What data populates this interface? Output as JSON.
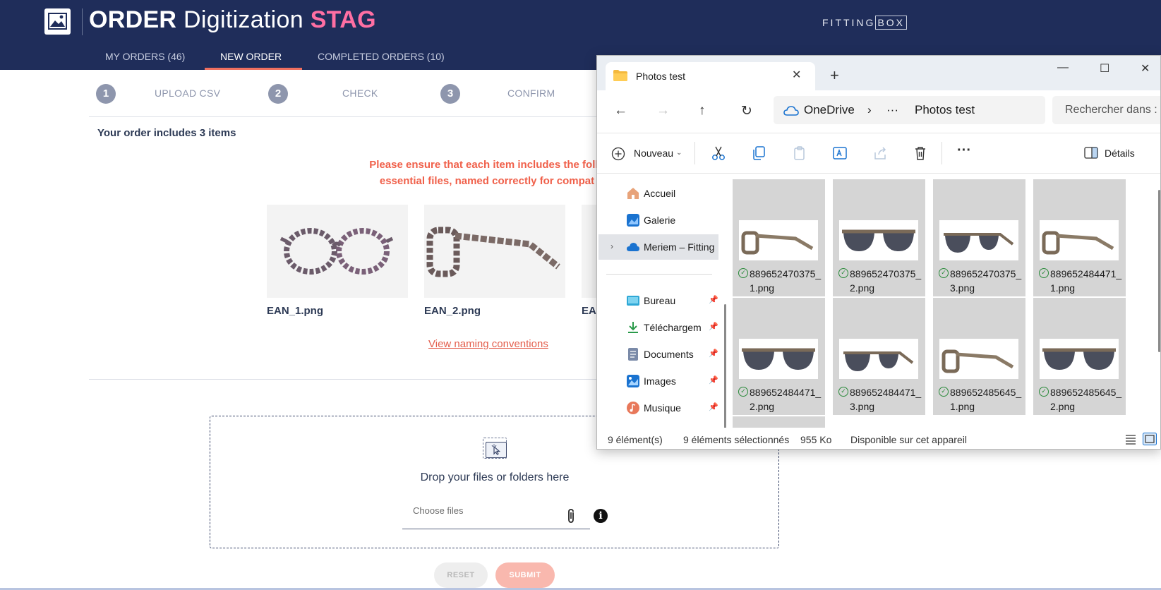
{
  "app": {
    "title_part1": "ORDER",
    "title_part2": "Digitization",
    "title_part3": "STAG",
    "partner_logo_text_1": "FITTING",
    "partner_logo_text_2": "BOX",
    "nav": [
      {
        "label": "MY ORDERS (46)"
      },
      {
        "label": "NEW ORDER"
      },
      {
        "label": "COMPLETED ORDERS (10)"
      }
    ],
    "steps": [
      {
        "num": "1",
        "label": "UPLOAD CSV"
      },
      {
        "num": "2",
        "label": "CHECK"
      },
      {
        "num": "3",
        "label": "CONFIRM"
      }
    ],
    "order_summary": "Your order includes 3 items",
    "warning_line1": "Please ensure that each item includes the follo",
    "warning_line2": "essential files, named correctly for compat",
    "examples": [
      {
        "name": "EAN_1.png"
      },
      {
        "name": "EAN_2.png"
      },
      {
        "name": "EA"
      }
    ],
    "naming_link": "View naming conventions",
    "drop_text": "Drop your files or folders here",
    "choose_placeholder": "Choose files",
    "info_glyph": "i",
    "reset_label": "RESET",
    "submit_label": "SUBMIT"
  },
  "explorer": {
    "tab_title": "Photos test",
    "address_root": "OneDrive",
    "address_sep": "›",
    "address_more": "···",
    "address_folder": "Photos test",
    "search_placeholder": "Rechercher dans :",
    "new_label": "Nouveau",
    "details_label": "Détails",
    "sidebar": [
      {
        "label": "Accueil",
        "icon": "home-icon",
        "pinned": false
      },
      {
        "label": "Galerie",
        "icon": "gallery-icon",
        "pinned": false
      },
      {
        "label": "Meriem – Fitting",
        "icon": "onedrive-icon",
        "pinned": false
      },
      {
        "label": "Bureau",
        "icon": "desktop-icon",
        "pinned": true
      },
      {
        "label": "Téléchargem",
        "icon": "download-icon",
        "pinned": true
      },
      {
        "label": "Documents",
        "icon": "documents-icon",
        "pinned": true
      },
      {
        "label": "Images",
        "icon": "images-icon",
        "pinned": true
      },
      {
        "label": "Musique",
        "icon": "music-icon",
        "pinned": true
      }
    ],
    "files": [
      {
        "name": "889652470375_1.png",
        "view": "side"
      },
      {
        "name": "889652470375_2.png",
        "view": "front"
      },
      {
        "name": "889652470375_3.png",
        "view": "angle"
      },
      {
        "name": "889652484471_ 1.png",
        "view": "side"
      },
      {
        "name": "889652484471_2.png",
        "view": "front"
      },
      {
        "name": "889652484471_3.png",
        "view": "angle"
      },
      {
        "name": "889652485645_1.png",
        "view": "side"
      },
      {
        "name": "889652485645_2.png",
        "view": "front"
      }
    ],
    "status_count": "9 élément(s)",
    "status_selected": "9 éléments sélectionnés",
    "status_size": "955 Ko",
    "status_avail": "Disponible sur cet appareil"
  }
}
